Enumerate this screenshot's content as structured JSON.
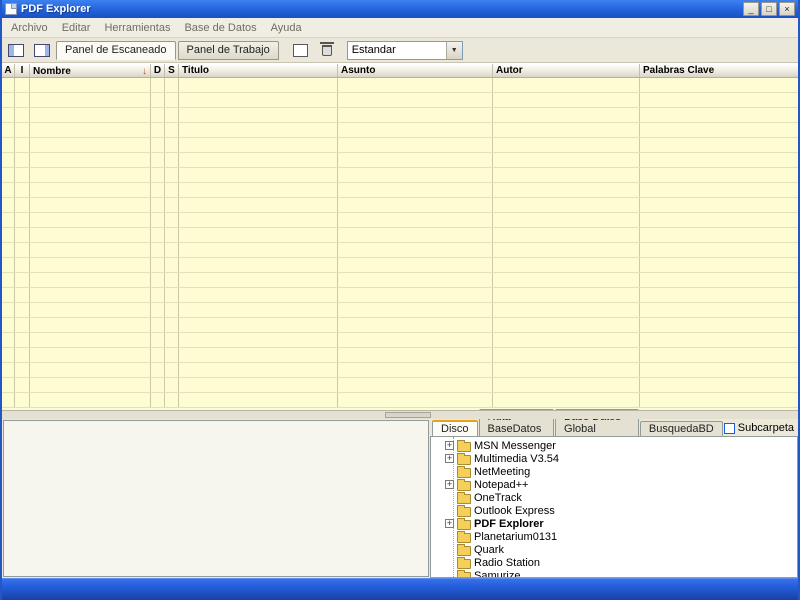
{
  "window": {
    "title": "PDF Explorer",
    "controls": {
      "minimize": "_",
      "maximize": "□",
      "close": "×"
    }
  },
  "menu": {
    "items": [
      "Archivo",
      "Editar",
      "Herramientas",
      "Base de Datos",
      "Ayuda"
    ]
  },
  "toolbar": {
    "panel_tabs": [
      {
        "label": "Panel de Escaneado",
        "active": true
      },
      {
        "label": "Panel de Trabajo",
        "active": false
      }
    ],
    "view_select": {
      "value": "Estandar"
    },
    "icons": [
      "scan-panel-icon",
      "work-panel-icon",
      "thumbnails-icon",
      "delete-icon",
      "chevron-down-icon"
    ],
    "dropdown_arrow": "▼"
  },
  "table": {
    "columns": [
      "A",
      "I",
      "Nombre",
      "D",
      "S",
      "Titulo",
      "Asunto",
      "Autor",
      "Palabras Clave"
    ],
    "sort": {
      "column": "Nombre",
      "direction": "desc",
      "indicator": "↓"
    },
    "row_count": 22
  },
  "bottom_panel": {
    "tabs": [
      {
        "label": "Disco",
        "active": true
      },
      {
        "label": "Ruta BaseDatos",
        "active": false
      },
      {
        "label": "Base Datos Global",
        "active": false
      },
      {
        "label": "BusquedaBD",
        "active": false
      }
    ],
    "subfolder_checkbox": {
      "label": "Subcarpeta",
      "checked": false
    },
    "tree": {
      "items": [
        {
          "label": "MSN Messenger",
          "expandable": true,
          "selected": false
        },
        {
          "label": "Multimedia V3.54",
          "expandable": true,
          "selected": false
        },
        {
          "label": "NetMeeting",
          "expandable": false,
          "selected": false
        },
        {
          "label": "Notepad++",
          "expandable": true,
          "selected": false
        },
        {
          "label": "OneTrack",
          "expandable": false,
          "selected": false
        },
        {
          "label": "Outlook Express",
          "expandable": false,
          "selected": false
        },
        {
          "label": "PDF Explorer",
          "expandable": true,
          "selected": true
        },
        {
          "label": "Planetarium0131",
          "expandable": false,
          "selected": false
        },
        {
          "label": "Quark",
          "expandable": false,
          "selected": false
        },
        {
          "label": "Radio Station",
          "expandable": false,
          "selected": false
        },
        {
          "label": "Samurize",
          "expandable": false,
          "selected": false
        }
      ]
    }
  },
  "colors": {
    "titlebar_blue": "#2767e0",
    "table_row_yellow": "#fdfcd2",
    "sort_arrow_red": "#c8500a",
    "statusbar_blue": "#245EDC"
  }
}
